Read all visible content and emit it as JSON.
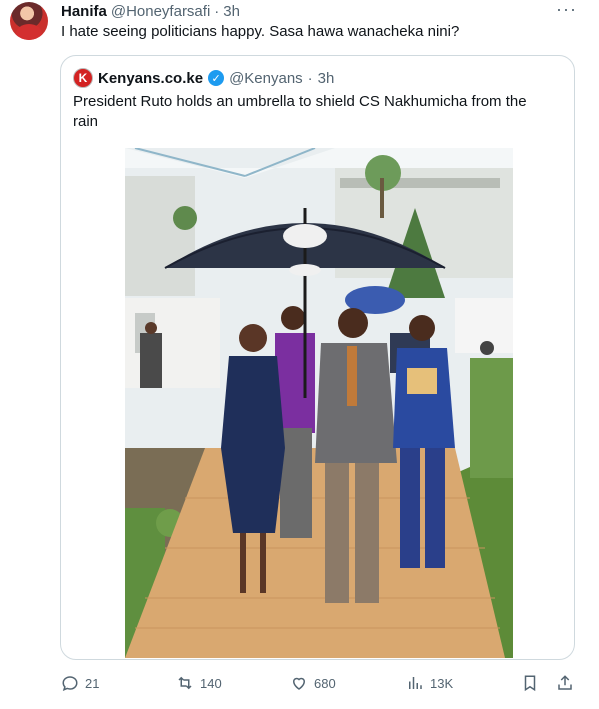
{
  "tweet": {
    "display_name": "Hanifa",
    "handle": "@Honeyfarsafi",
    "separator": "·",
    "time": "3h",
    "text": "I hate seeing politicians happy. Sasa hawa wanacheka nini?",
    "more_icon": "more-horizontal-icon"
  },
  "quote": {
    "logo_letter": "K",
    "display_name": "Kenyans.co.ke",
    "handle": "@Kenyans",
    "separator": "·",
    "time": "3h",
    "text": "President Ruto holds an umbrella to shield CS Nakhumicha from the rain",
    "verified_color": "#1d9bf0",
    "logo_color": "#d32222"
  },
  "actions": {
    "replies": "21",
    "reposts": "140",
    "likes": "680",
    "views": "13K"
  }
}
